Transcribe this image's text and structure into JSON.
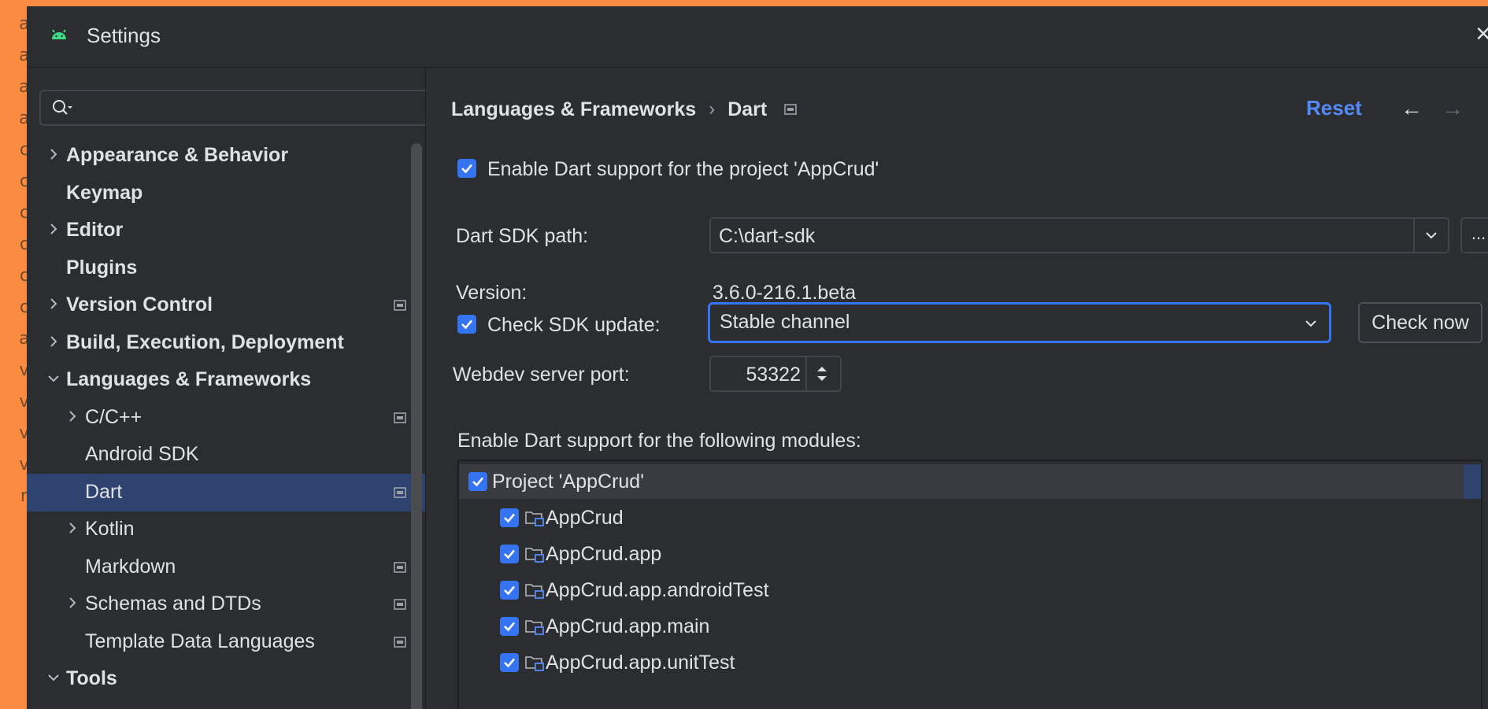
{
  "window": {
    "title": "Settings"
  },
  "background_editor": {
    "glyphs": [
      "a",
      "a",
      "a",
      "a",
      "c",
      "c",
      "c",
      "c",
      "c",
      "c",
      "a",
      "v",
      "v",
      "v",
      "v",
      "r"
    ]
  },
  "sidebar": {
    "search_placeholder": "",
    "items": [
      {
        "label": "Appearance & Behavior",
        "level": 0,
        "expander": "collapsed",
        "bold": true,
        "badge": false
      },
      {
        "label": "Keymap",
        "level": 0,
        "expander": "none",
        "bold": true,
        "badge": false
      },
      {
        "label": "Editor",
        "level": 0,
        "expander": "collapsed",
        "bold": true,
        "badge": false
      },
      {
        "label": "Plugins",
        "level": 0,
        "expander": "none",
        "bold": true,
        "badge": false
      },
      {
        "label": "Version Control",
        "level": 0,
        "expander": "collapsed",
        "bold": true,
        "badge": true
      },
      {
        "label": "Build, Execution, Deployment",
        "level": 0,
        "expander": "collapsed",
        "bold": true,
        "badge": false
      },
      {
        "label": "Languages & Frameworks",
        "level": 0,
        "expander": "expanded",
        "bold": true,
        "badge": false
      },
      {
        "label": "C/C++",
        "level": 1,
        "expander": "collapsed",
        "bold": false,
        "badge": true
      },
      {
        "label": "Android SDK",
        "level": 1,
        "expander": "none",
        "bold": false,
        "badge": false
      },
      {
        "label": "Dart",
        "level": 1,
        "expander": "none",
        "bold": false,
        "badge": true,
        "selected": true
      },
      {
        "label": "Kotlin",
        "level": 1,
        "expander": "collapsed",
        "bold": false,
        "badge": false
      },
      {
        "label": "Markdown",
        "level": 1,
        "expander": "none",
        "bold": false,
        "badge": true
      },
      {
        "label": "Schemas and DTDs",
        "level": 1,
        "expander": "collapsed",
        "bold": false,
        "badge": true
      },
      {
        "label": "Template Data Languages",
        "level": 1,
        "expander": "none",
        "bold": false,
        "badge": true
      },
      {
        "label": "Tools",
        "level": 0,
        "expander": "expanded",
        "bold": true,
        "badge": false
      }
    ]
  },
  "breadcrumb": {
    "parent": "Languages & Frameworks",
    "separator": "›",
    "current": "Dart"
  },
  "header": {
    "reset_label": "Reset",
    "back_glyph": "←",
    "forward_glyph": "→"
  },
  "form": {
    "enable_project": {
      "label": "Enable Dart support for the project 'AppCrud'",
      "checked": true
    },
    "sdk_path": {
      "label": "Dart SDK path:",
      "value": "C:\\dart-sdk",
      "browse_label": "..."
    },
    "version": {
      "label": "Version:",
      "value": "3.6.0-216.1.beta"
    },
    "check_update": {
      "label": "Check SDK update:",
      "checked": true,
      "channel": "Stable channel",
      "check_now_label": "Check now"
    },
    "webdev_port": {
      "label": "Webdev server port:",
      "value": "53322"
    },
    "modules": {
      "label": "Enable Dart support for the following modules:",
      "items": [
        {
          "label": "Project 'AppCrud'",
          "level": 0,
          "checked": true,
          "folder": false,
          "selected": true
        },
        {
          "label": "AppCrud",
          "level": 1,
          "checked": true,
          "folder": true
        },
        {
          "label": "AppCrud.app",
          "level": 1,
          "checked": true,
          "folder": true
        },
        {
          "label": "AppCrud.app.androidTest",
          "level": 1,
          "checked": true,
          "folder": true
        },
        {
          "label": "AppCrud.app.main",
          "level": 1,
          "checked": true,
          "folder": true
        },
        {
          "label": "AppCrud.app.unitTest",
          "level": 1,
          "checked": true,
          "folder": true
        }
      ]
    }
  },
  "colors": {
    "accent": "#3574f0",
    "link": "#548af7",
    "selection": "#2e436e",
    "frame": "#fa8c42"
  }
}
